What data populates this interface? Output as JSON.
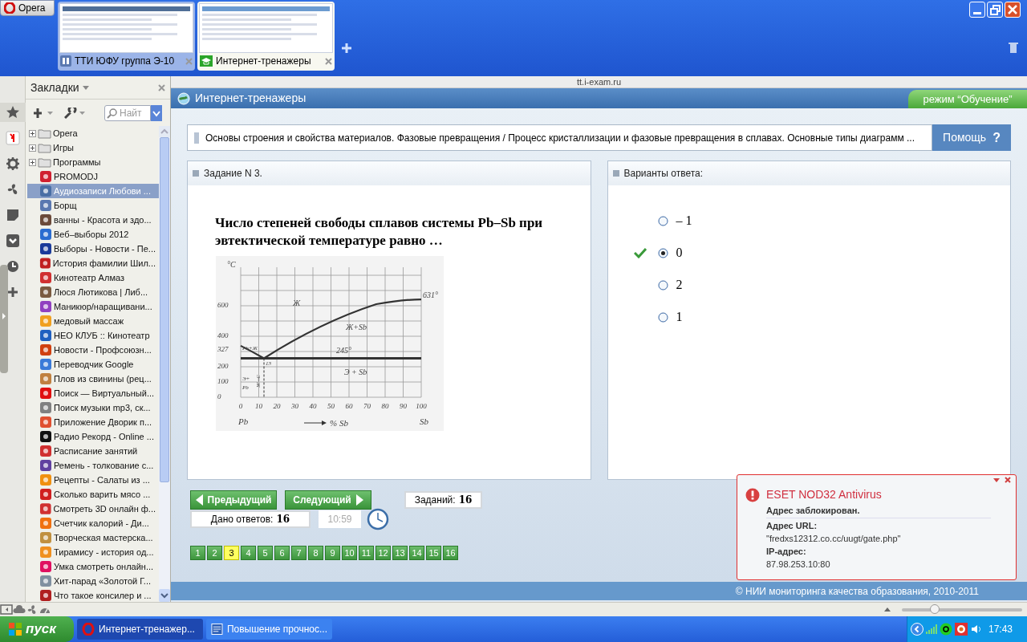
{
  "opera_button": "Opera",
  "browser_tabs": [
    {
      "title": "ТТИ ЮФУ группа Э-10",
      "selected": false
    },
    {
      "title": "Интернет-тренажеры",
      "selected": true
    }
  ],
  "bookmarks_panel": {
    "title": "Закладки",
    "search_placeholder": "Найт",
    "items": [
      {
        "kind": "folder",
        "label": "Opera",
        "selected": false
      },
      {
        "kind": "folder",
        "label": "Игры",
        "selected": false
      },
      {
        "kind": "folder",
        "label": "Программы",
        "selected": false
      },
      {
        "kind": "link",
        "label": "PROMODJ",
        "selected": false,
        "color": "#d02030"
      },
      {
        "kind": "link",
        "label": "Аудиозаписи Любови ...",
        "selected": true,
        "color": "#4a6fa5"
      },
      {
        "kind": "link",
        "label": "Борщ",
        "selected": false,
        "color": "#5a78b0"
      },
      {
        "kind": "link",
        "label": "ванны - Красота и здо...",
        "selected": false,
        "color": "#6b4a3a"
      },
      {
        "kind": "link",
        "label": "Веб–выборы 2012",
        "selected": false,
        "color": "#2a6cd0"
      },
      {
        "kind": "link",
        "label": "Выборы - Новости - Пе...",
        "selected": false,
        "color": "#1a3a9a"
      },
      {
        "kind": "link",
        "label": "История фамилии Шил...",
        "selected": false,
        "color": "#c02020"
      },
      {
        "kind": "link",
        "label": "Кинотеатр Алмаз",
        "selected": false,
        "color": "#d03030"
      },
      {
        "kind": "link",
        "label": "Люся Лютикова | Либ...",
        "selected": false,
        "color": "#7a5a40"
      },
      {
        "kind": "link",
        "label": "Маникюр/наращивани...",
        "selected": false,
        "color": "#9040c0"
      },
      {
        "kind": "link",
        "label": "медовый массаж",
        "selected": false,
        "color": "#f0a020"
      },
      {
        "kind": "link",
        "label": "НЕО КЛУБ :: Кинотеатр",
        "selected": false,
        "color": "#2060c0"
      },
      {
        "kind": "link",
        "label": "Новости - Профсоюзн...",
        "selected": false,
        "color": "#d04010"
      },
      {
        "kind": "link",
        "label": "Переводчик Google",
        "selected": false,
        "color": "#3a7ad8"
      },
      {
        "kind": "link",
        "label": "Плов из свинины (рец...",
        "selected": false,
        "color": "#c08040"
      },
      {
        "kind": "link",
        "label": "Поиск — Виртуальный...",
        "selected": false,
        "color": "#e01010"
      },
      {
        "kind": "link",
        "label": "Поиск музыки mp3, ск...",
        "selected": false,
        "color": "#808080"
      },
      {
        "kind": "link",
        "label": "Приложение Дворик п...",
        "selected": false,
        "color": "#e05030"
      },
      {
        "kind": "link",
        "label": "Радио Рекорд - Online ...",
        "selected": false,
        "color": "#101010"
      },
      {
        "kind": "link",
        "label": "Расписание занятий",
        "selected": false,
        "color": "#d03030"
      },
      {
        "kind": "link",
        "label": "Ремень - толкование с...",
        "selected": false,
        "color": "#6040a0"
      },
      {
        "kind": "link",
        "label": "Рецепты - Салаты из ...",
        "selected": false,
        "color": "#f09010"
      },
      {
        "kind": "link",
        "label": "Сколько варить мясо ...",
        "selected": false,
        "color": "#d02020"
      },
      {
        "kind": "link",
        "label": "Смотреть 3D онлайн ф...",
        "selected": false,
        "color": "#d03030"
      },
      {
        "kind": "link",
        "label": "Счетчик калорий - Ди...",
        "selected": false,
        "color": "#f07010"
      },
      {
        "kind": "link",
        "label": "Творческая мастерска...",
        "selected": false,
        "color": "#c09040"
      },
      {
        "kind": "link",
        "label": "Тирамису - история од...",
        "selected": false,
        "color": "#f09020"
      },
      {
        "kind": "link",
        "label": "Умка смотреть онлайн...",
        "selected": false,
        "color": "#e01060"
      },
      {
        "kind": "link",
        "label": "Хит-парад «Золотой Г...",
        "selected": false,
        "color": "#8090a0"
      },
      {
        "kind": "link",
        "label": "Что такое консилер и ...",
        "selected": false,
        "color": "#b02020"
      }
    ]
  },
  "address": "tt.i-exam.ru",
  "site": {
    "title": "Интернет-тренажеры",
    "mode": "режим “Обучение”",
    "breadcrumb": "Основы строения и свойства материалов. Фазовые превращения / Процесс кристаллизации и фазовые превращения в сплавах. Основные типы диаграмм ...",
    "help_button": {
      "label": "Помощь",
      "icon": "?"
    },
    "task": {
      "title": "Задание N 3.",
      "question": "Число степеней свободы сплавов системы Pb–Sb при эвтектической температуре равно …",
      "diagram": {
        "y_unit": "°C",
        "y_labels": [
          "600",
          "400",
          "327",
          "200",
          "100",
          "0"
        ],
        "x_labels": [
          "0",
          "10",
          "20",
          "30",
          "40",
          "50",
          "60",
          "70",
          "80",
          "90",
          "100"
        ],
        "left_component": "Pb",
        "right_component": "Sb",
        "x_title": "% Sb",
        "region_labels": [
          "Ж",
          "Ж+Sb",
          "245°",
          "631°",
          "Э + Sb",
          "Pb+Ж",
          "Э+",
          "Pb",
          "13",
          "Э+Ж"
        ]
      }
    },
    "answers": {
      "title": "Варианты ответа:",
      "options": [
        {
          "label": "– 1",
          "selected": false,
          "correct": false
        },
        {
          "label": "0",
          "selected": true,
          "correct": true
        },
        {
          "label": "2",
          "selected": false,
          "correct": false
        },
        {
          "label": "1",
          "selected": false,
          "correct": false
        }
      ]
    },
    "prev_button": "Предыдущий",
    "next_button": "Следующий",
    "tasks_total": {
      "label": "Заданий:",
      "value": "16"
    },
    "answered": {
      "label": "Дано ответов:",
      "value": "16"
    },
    "timer": "10:59",
    "pages": [
      {
        "label": "1",
        "selected": false
      },
      {
        "label": "2",
        "selected": false
      },
      {
        "label": "3",
        "selected": true
      },
      {
        "label": "4",
        "selected": false
      },
      {
        "label": "5",
        "selected": false
      },
      {
        "label": "6",
        "selected": false
      },
      {
        "label": "7",
        "selected": false
      },
      {
        "label": "8",
        "selected": false
      },
      {
        "label": "9",
        "selected": false
      },
      {
        "label": "10",
        "selected": false
      },
      {
        "label": "11",
        "selected": false
      },
      {
        "label": "12",
        "selected": false
      },
      {
        "label": "13",
        "selected": false
      },
      {
        "label": "14",
        "selected": false
      },
      {
        "label": "15",
        "selected": false
      },
      {
        "label": "16",
        "selected": false
      }
    ],
    "footer": "© НИИ мониторинга качества образования, 2010-2011"
  },
  "antivirus_popup": {
    "title": "ESET NOD32 Antivirus",
    "message": "Адрес заблокирован.",
    "url_label": "Адрес URL:",
    "url": "\"fredxs12312.co.cc/uugt/gate.php\"",
    "ip_label": "IP-адрес:",
    "ip": "87.98.253.10:80"
  },
  "zoom_slider": {
    "level": 0.27
  },
  "taskbar": {
    "start": "пуск",
    "tasks": [
      {
        "title": "Интернет-тренажер...",
        "selected": true
      },
      {
        "title": "Повышение прочнос...",
        "selected": false
      }
    ],
    "clock": "17:43"
  }
}
